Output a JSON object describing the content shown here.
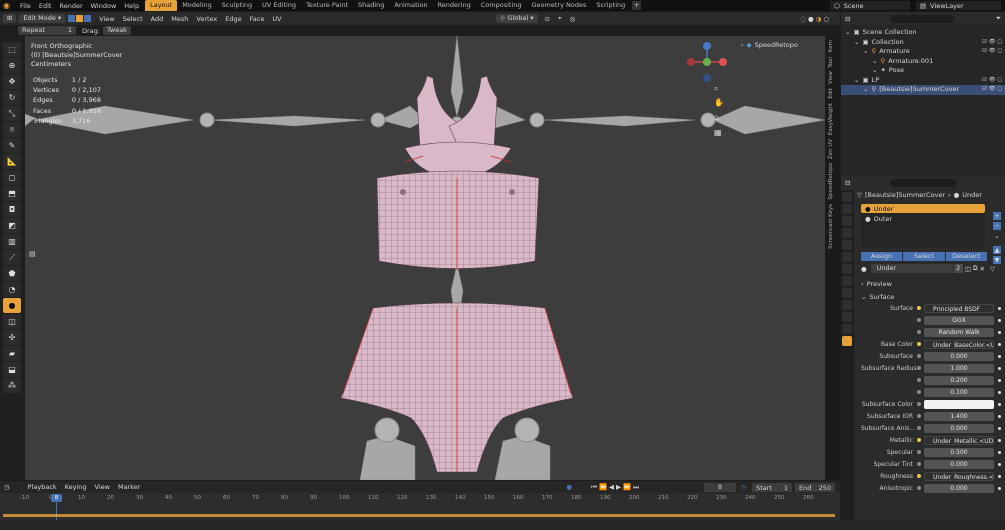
{
  "topbar": {
    "menus": [
      "File",
      "Edit",
      "Render",
      "Window",
      "Help"
    ],
    "workspaces": [
      "Layout",
      "Modeling",
      "Sculpting",
      "UV Editing",
      "Texture Paint",
      "Shading",
      "Animation",
      "Rendering",
      "Compositing",
      "Geometry Nodes",
      "Scripting"
    ],
    "active_workspace": "Layout",
    "scene": "Scene",
    "view_layer": "ViewLayer"
  },
  "header": {
    "mode": "Edit Mode",
    "menus": [
      "View",
      "Select",
      "Add",
      "Mesh",
      "Vertex",
      "Edge",
      "Face",
      "UV"
    ],
    "transform_orientation": "Global",
    "options": "Options"
  },
  "subheader": {
    "repeat": "Repeat",
    "repeat_value": "1",
    "drag": "Drag:",
    "drag_value": "Tweak"
  },
  "overlay": {
    "view": "Front Orthographic",
    "object": "(0) [Beautsie]SummerCover",
    "units": "Centimeters"
  },
  "stats": [
    [
      "Objects",
      "1 / 2"
    ],
    [
      "Vertices",
      "0 / 2,107"
    ],
    [
      "Edges",
      "0 / 3,968"
    ],
    [
      "Faces",
      "0 / 1,858"
    ],
    [
      "Triangles",
      "3,716"
    ]
  ],
  "right_tabs": [
    "Item",
    "Tool",
    "View",
    "Edit",
    "EasyWeight",
    "Zen UV",
    "SpeedRetopo",
    "Screencast Keys"
  ],
  "speedretopo": "SpeedRetopo",
  "outliner": {
    "rows": [
      {
        "label": "Scene Collection",
        "indent": 0
      },
      {
        "label": "Collection",
        "indent": 1
      },
      {
        "label": "Armature",
        "indent": 2
      },
      {
        "label": "Armature.001",
        "indent": 3
      },
      {
        "label": "Pose",
        "indent": 3
      },
      {
        "label": "LP",
        "indent": 1
      },
      {
        "label": "[Beautsie]SummerCover",
        "indent": 2
      }
    ]
  },
  "props": {
    "object_name": "[Beautsie]SummerCover",
    "material_name": "Under",
    "slots": [
      "Under",
      "Outer"
    ],
    "buttons": {
      "assign": "Assign",
      "select": "Select",
      "deselect": "Deselect"
    },
    "mat_field": "Under",
    "mat_users": "2",
    "preview": "Preview",
    "surface_section": "Surface",
    "rows": [
      {
        "label": "Surface",
        "value": "Principled BSDF",
        "kind": "link"
      },
      {
        "label": "",
        "value": "GGX",
        "kind": "drop"
      },
      {
        "label": "",
        "value": "Random Walk",
        "kind": "drop"
      },
      {
        "label": "Base Color",
        "value": "Under_BaseColor.<U...",
        "kind": "link"
      },
      {
        "label": "Subsurface",
        "value": "0.000",
        "kind": "num"
      },
      {
        "label": "Subsurface Radius",
        "value": "1.000",
        "kind": "num"
      },
      {
        "label": "",
        "value": "0.200",
        "kind": "num"
      },
      {
        "label": "",
        "value": "0.100",
        "kind": "num"
      },
      {
        "label": "Subsurface Color",
        "value": "",
        "kind": "color"
      },
      {
        "label": "Subsurface IOR",
        "value": "1.400",
        "kind": "num"
      },
      {
        "label": "Subsurface Anis...",
        "value": "0.000",
        "kind": "num"
      },
      {
        "label": "Metallic",
        "value": "Under_Metallic.<UDIM...",
        "kind": "link"
      },
      {
        "label": "Specular",
        "value": "0.500",
        "kind": "num"
      },
      {
        "label": "Specular Tint",
        "value": "0.000",
        "kind": "num"
      },
      {
        "label": "Roughness",
        "value": "Under_Roughness.<U...",
        "kind": "link"
      },
      {
        "label": "Anisotropic",
        "value": "0.000",
        "kind": "num"
      }
    ]
  },
  "timeline": {
    "menus": [
      "Playback",
      "Keying",
      "View",
      "Marker"
    ],
    "current_frame": "8",
    "start_label": "Start",
    "start": "1",
    "end_label": "End",
    "end": "250",
    "ticks": [
      "-10",
      "0",
      "10",
      "20",
      "30",
      "40",
      "50",
      "60",
      "70",
      "80",
      "90",
      "100",
      "110",
      "120",
      "130",
      "140",
      "150",
      "160",
      "170",
      "180",
      "190",
      "200",
      "210",
      "220",
      "230",
      "240",
      "250",
      "260"
    ],
    "playhead": "8"
  },
  "colors": {
    "accent": "#e8a23a",
    "selection": "#3a4f78",
    "mesh": "#d9b8c8",
    "bone": "#a7a7a7"
  }
}
